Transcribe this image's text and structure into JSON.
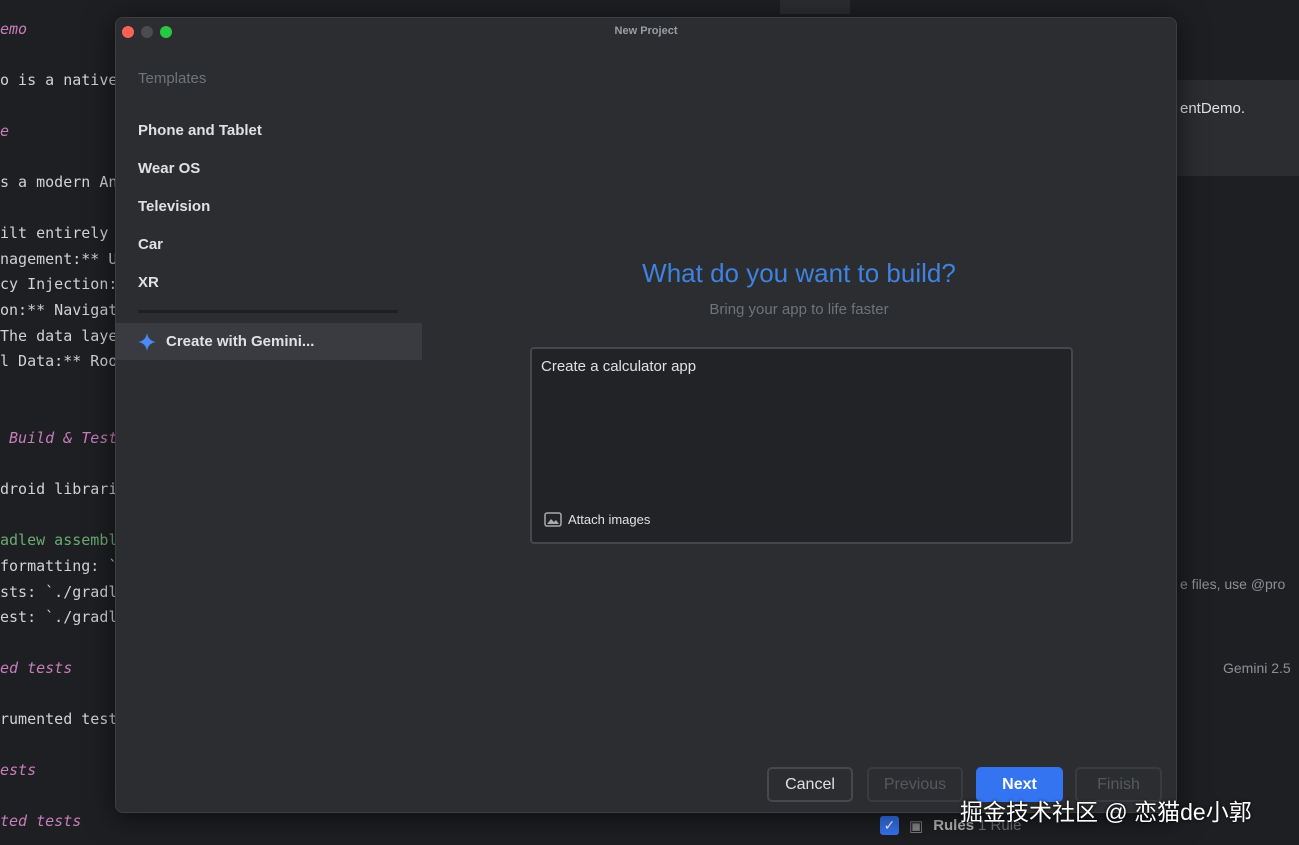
{
  "editor": {
    "lines": [
      {
        "text": "emo",
        "style": "it"
      },
      {
        "text": "o is a native",
        "style": ""
      },
      {
        "text": "e",
        "style": "it"
      },
      {
        "text": "s a modern An",
        "style": ""
      },
      {
        "text": "ilt entirely",
        "style": ""
      },
      {
        "text": "nagement:** U",
        "style": ""
      },
      {
        "text": "cy Injection:",
        "style": ""
      },
      {
        "text": "on:** Navigat",
        "style": ""
      },
      {
        "text": "The data laye",
        "style": ""
      },
      {
        "text": "l Data:** Roo",
        "style": ""
      },
      {
        "text": " Build & Test",
        "style": "it"
      },
      {
        "text": "droid librari",
        "style": ""
      },
      {
        "text": "adlew assembl",
        "style": "gr"
      },
      {
        "text": "formatting: `",
        "style": ""
      },
      {
        "text": "sts: `./gradl",
        "style": ""
      },
      {
        "text": "est: `./gradl",
        "style": ""
      },
      {
        "text": "ed tests",
        "style": "it"
      },
      {
        "text": "rumented test",
        "style": ""
      },
      {
        "text": "ests",
        "style": "it"
      },
      {
        "text": "ted tests",
        "style": "it"
      }
    ]
  },
  "right_panel": {
    "text1": "entDemo.",
    "text2": "e files, use @pro",
    "model": "Gemini 2.5",
    "rules_label": "Rules",
    "rules_count": "1 Rule"
  },
  "dialog": {
    "title": "New Project",
    "sidebar": {
      "header": "Templates",
      "items": [
        "Phone and Tablet",
        "Wear OS",
        "Television",
        "Car",
        "XR"
      ],
      "gemini": "Create with Gemini..."
    },
    "heading": "What do you want to build?",
    "subheading": "Bring your app to life faster",
    "prompt_value": "Create a calculator app",
    "attach_label": "Attach images",
    "buttons": {
      "cancel": "Cancel",
      "previous": "Previous",
      "next": "Next",
      "finish": "Finish"
    }
  },
  "watermark": "掘金技术社区 @ 恋猫de小郭",
  "colors": {
    "accent": "#3574f0",
    "heading": "#3f82e0"
  }
}
